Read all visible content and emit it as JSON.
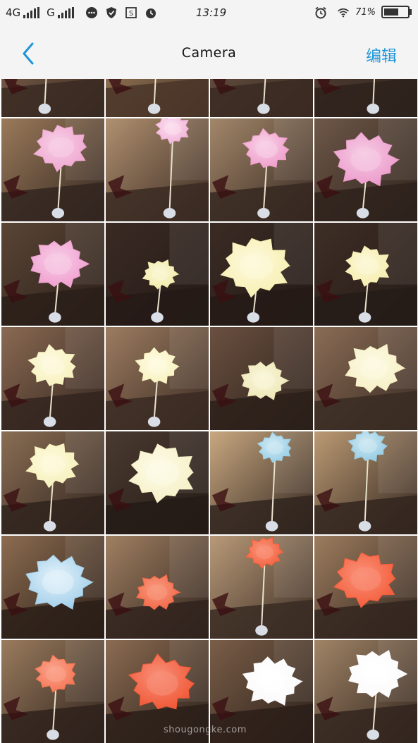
{
  "status_bar": {
    "network_1": "4G",
    "network_2": "G",
    "time": "13:19",
    "battery_text": "71%",
    "battery_level": 0.71,
    "icons": [
      "signal-icon",
      "message-icon",
      "shield-icon",
      "screenshot-icon",
      "alarm-icon",
      "alarm-icon",
      "wifi-icon",
      "battery-icon"
    ]
  },
  "nav": {
    "title": "Camera",
    "edit_label": "编辑",
    "back_icon": "back-chevron-icon"
  },
  "colors": {
    "accent": "#1e95d8",
    "bar_bg": "#f4f4f4"
  },
  "watermark": "shougongke.com",
  "photos": [
    {
      "bg": "#8a6a52",
      "table": "#3a2a22",
      "flower": "#ffffff",
      "accent": "#f2eee6",
      "size": 0.25,
      "fx": 0.45,
      "fy": 0.2,
      "stem": true
    },
    {
      "bg": "#a88862",
      "table": "#4a3528",
      "flower": "#ffffff",
      "accent": "#eee",
      "size": 0.2,
      "fx": 0.5,
      "fy": 0.2,
      "stem": true
    },
    {
      "bg": "#6e5a48",
      "table": "#3b2a22",
      "flower": "#f0ece0",
      "accent": "#ddd",
      "size": 0.2,
      "fx": 0.55,
      "fy": 0.3,
      "stem": true
    },
    {
      "bg": "#5a4538",
      "table": "#2e221c",
      "flower": "#bfe0ec",
      "accent": "#ffffff",
      "size": 0.25,
      "fx": 0.6,
      "fy": 0.1,
      "stem": true
    },
    {
      "bg": "#9a7a5a",
      "table": "#332620",
      "flower": "#f0a8d0",
      "accent": "#f7cfe6",
      "size": 0.28,
      "fx": 0.58,
      "fy": 0.28,
      "stem": true
    },
    {
      "bg": "#b09070",
      "table": "#3a2a22",
      "flower": "#f2b6da",
      "accent": "#fbe0ef",
      "size": 0.18,
      "fx": 0.65,
      "fy": 0.1,
      "stem": true
    },
    {
      "bg": "#a3876a",
      "table": "#362821",
      "flower": "#f0a0cc",
      "accent": "#f8d2e8",
      "size": 0.24,
      "fx": 0.55,
      "fy": 0.3,
      "stem": true
    },
    {
      "bg": "#6e5848",
      "table": "#2e221c",
      "flower": "#ec9ccc",
      "accent": "#f6cce4",
      "size": 0.33,
      "fx": 0.5,
      "fy": 0.4,
      "stem": true
    },
    {
      "bg": "#5a4535",
      "table": "#2a1f19",
      "flower": "#f0a0d0",
      "accent": "#f7cde6",
      "size": 0.3,
      "fx": 0.55,
      "fy": 0.4,
      "stem": true
    },
    {
      "bg": "#3a2a24",
      "table": "#241a16",
      "flower": "#f3ecae",
      "accent": "#faf6d4",
      "size": 0.18,
      "fx": 0.53,
      "fy": 0.5,
      "stem": true
    },
    {
      "bg": "#3a2b24",
      "table": "#241a16",
      "flower": "#f7f0b4",
      "accent": "#fdf9dc",
      "size": 0.36,
      "fx": 0.45,
      "fy": 0.42,
      "stem": true
    },
    {
      "bg": "#3e2e26",
      "table": "#261c17",
      "flower": "#f6eeb0",
      "accent": "#fcf8d8",
      "size": 0.24,
      "fx": 0.52,
      "fy": 0.42,
      "stem": true
    },
    {
      "bg": "#8a6a52",
      "table": "#33251f",
      "flower": "#f8f2c0",
      "accent": "#fdfae0",
      "size": 0.25,
      "fx": 0.5,
      "fy": 0.38,
      "stem": true
    },
    {
      "bg": "#9c7c60",
      "table": "#3a2a22",
      "flower": "#f9f3c2",
      "accent": "#fefbe2",
      "size": 0.22,
      "fx": 0.5,
      "fy": 0.38,
      "stem": true
    },
    {
      "bg": "#6a5040",
      "table": "#2c201a",
      "flower": "#eee8b8",
      "accent": "#faf6da",
      "size": 0.24,
      "fx": 0.52,
      "fy": 0.52,
      "stem": false
    },
    {
      "bg": "#8a6c55",
      "table": "#3a2b23",
      "flower": "#f6f0c6",
      "accent": "#fdfae4",
      "size": 0.3,
      "fx": 0.58,
      "fy": 0.4,
      "stem": false
    },
    {
      "bg": "#8a6e54",
      "table": "#2f231d",
      "flower": "#f7f1bc",
      "accent": "#fdfade",
      "size": 0.27,
      "fx": 0.5,
      "fy": 0.32,
      "stem": true
    },
    {
      "bg": "#4a3a30",
      "table": "#241b16",
      "flower": "#f6f1c8",
      "accent": "#fdfbe8",
      "size": 0.35,
      "fx": 0.55,
      "fy": 0.4,
      "stem": false
    },
    {
      "bg": "#c8a880",
      "table": "#30241e",
      "flower": "#9dd0e6",
      "accent": "#d0eaf4",
      "size": 0.18,
      "fx": 0.63,
      "fy": 0.16,
      "stem": true
    },
    {
      "bg": "#bb9a74",
      "table": "#33261f",
      "flower": "#98cde4",
      "accent": "#cfe9f3",
      "size": 0.2,
      "fx": 0.52,
      "fy": 0.14,
      "stem": true
    },
    {
      "bg": "#8c6c50",
      "table": "#2a1e18",
      "flower": "#a4d0ea",
      "accent": "#e4f2fa",
      "size": 0.34,
      "fx": 0.55,
      "fy": 0.45,
      "stem": false
    },
    {
      "bg": "#a08062",
      "table": "#30231d",
      "flower": "#f26a4a",
      "accent": "#f89a80",
      "size": 0.22,
      "fx": 0.5,
      "fy": 0.55,
      "stem": false
    },
    {
      "bg": "#b89a78",
      "table": "#3a2b23",
      "flower": "#f4623f",
      "accent": "#f9957c",
      "size": 0.19,
      "fx": 0.53,
      "fy": 0.16,
      "stem": true
    },
    {
      "bg": "#9c7c5e",
      "table": "#33261f",
      "flower": "#f45e3c",
      "accent": "#f9927a",
      "size": 0.33,
      "fx": 0.5,
      "fy": 0.42,
      "stem": false
    },
    {
      "bg": "#9a7c5e",
      "table": "#2f221c",
      "flower": "#f57856",
      "accent": "#fba590",
      "size": 0.22,
      "fx": 0.53,
      "fy": 0.33,
      "stem": true
    },
    {
      "bg": "#8c6c52",
      "table": "#2a1f19",
      "flower": "#f05a38",
      "accent": "#f8907a",
      "size": 0.34,
      "fx": 0.55,
      "fy": 0.42,
      "stem": false
    },
    {
      "bg": "#7a5e48",
      "table": "#2b1f19",
      "flower": "#fafafa",
      "accent": "#ffffff",
      "size": 0.3,
      "fx": 0.6,
      "fy": 0.4,
      "stem": false
    },
    {
      "bg": "#a08466",
      "table": "#33261f",
      "flower": "#fbfbfb",
      "accent": "#ffffff",
      "size": 0.3,
      "fx": 0.6,
      "fy": 0.33,
      "stem": true
    }
  ]
}
